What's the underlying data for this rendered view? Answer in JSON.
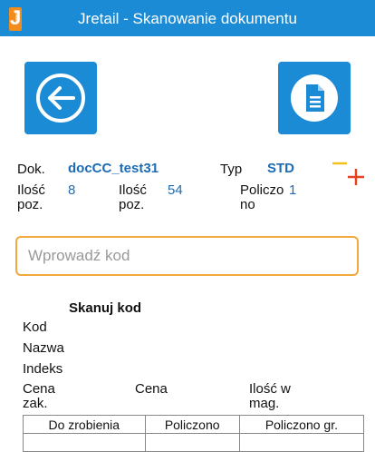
{
  "app": {
    "logo_letter": "J",
    "logo_small": "retail",
    "title": "Jretail - Skanowanie dokumentu"
  },
  "colors": {
    "primary": "#1c8bd6",
    "accent": "#f28c1a",
    "value": "#1c6bb5"
  },
  "toolbar": {
    "back_icon": "arrow-left-circle-icon",
    "document_icon": "document-icon"
  },
  "info": {
    "dok_label": "Dok.",
    "dok_value": "docCC_test31",
    "typ_label": "Typ",
    "typ_value": "STD",
    "ilosc_poz_label_1": "Ilość",
    "ilosc_poz_label_2": "poz.",
    "ilosc_poz_value": "8",
    "ilosc_poz2_label_1": "Ilość",
    "ilosc_poz2_label_2": "poz.",
    "ilosc_poz2_value": "54",
    "policzono_label_1": "Policzo",
    "policzono_label_2": "no",
    "policzono_value": "1"
  },
  "search": {
    "placeholder": "Wprowadź kod"
  },
  "scan": {
    "title": "Skanuj kod",
    "kod_label": "Kod",
    "nazwa_label": "Nazwa",
    "indeks_label": "Indeks",
    "cena_zak_label_1": "Cena",
    "cena_zak_label_2": "zak.",
    "cena_label": "Cena",
    "ilosc_mag_label_1": "Ilość w",
    "ilosc_mag_label_2": "mag."
  },
  "table": {
    "headers": [
      "Do zrobienia",
      "Policzono",
      "Policzono gr."
    ]
  }
}
